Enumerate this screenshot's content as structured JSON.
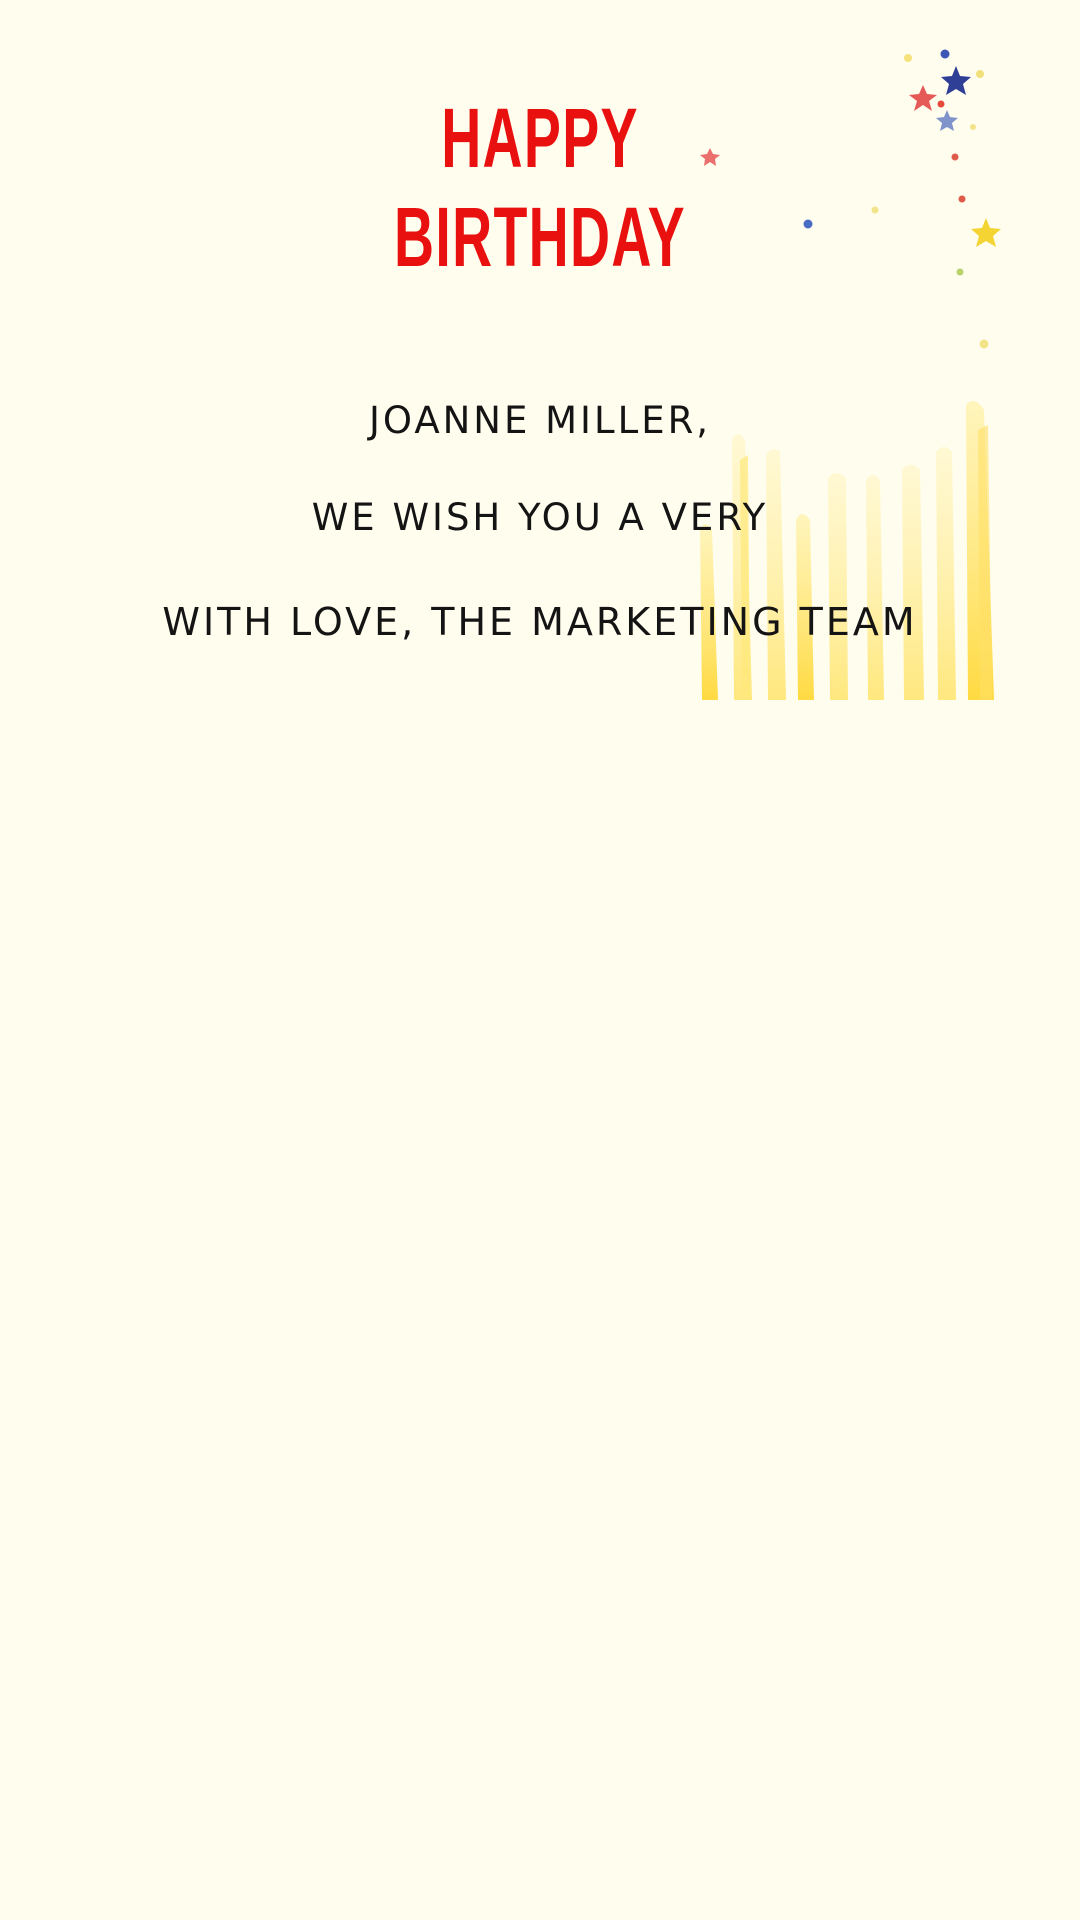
{
  "card": {
    "title_line_1": "HAPPY",
    "title_line_2": "BIRTHDAY",
    "recipient": "JOANNE MILLER,",
    "wish": "WE WISH YOU A VERY",
    "signature": "WITH LOVE, THE MARKETING TEAM"
  },
  "decorations": {
    "confetti": "confetti-stars-icon",
    "candles": "candle-stripes-icon"
  },
  "colors": {
    "background": "#fffdee",
    "title": "#e8110f",
    "text": "#141414",
    "candle_yellow": "#ffd838",
    "star_blue": "#2f3f95",
    "star_red": "#e03c3c",
    "star_yellow": "#f2cf1d"
  }
}
